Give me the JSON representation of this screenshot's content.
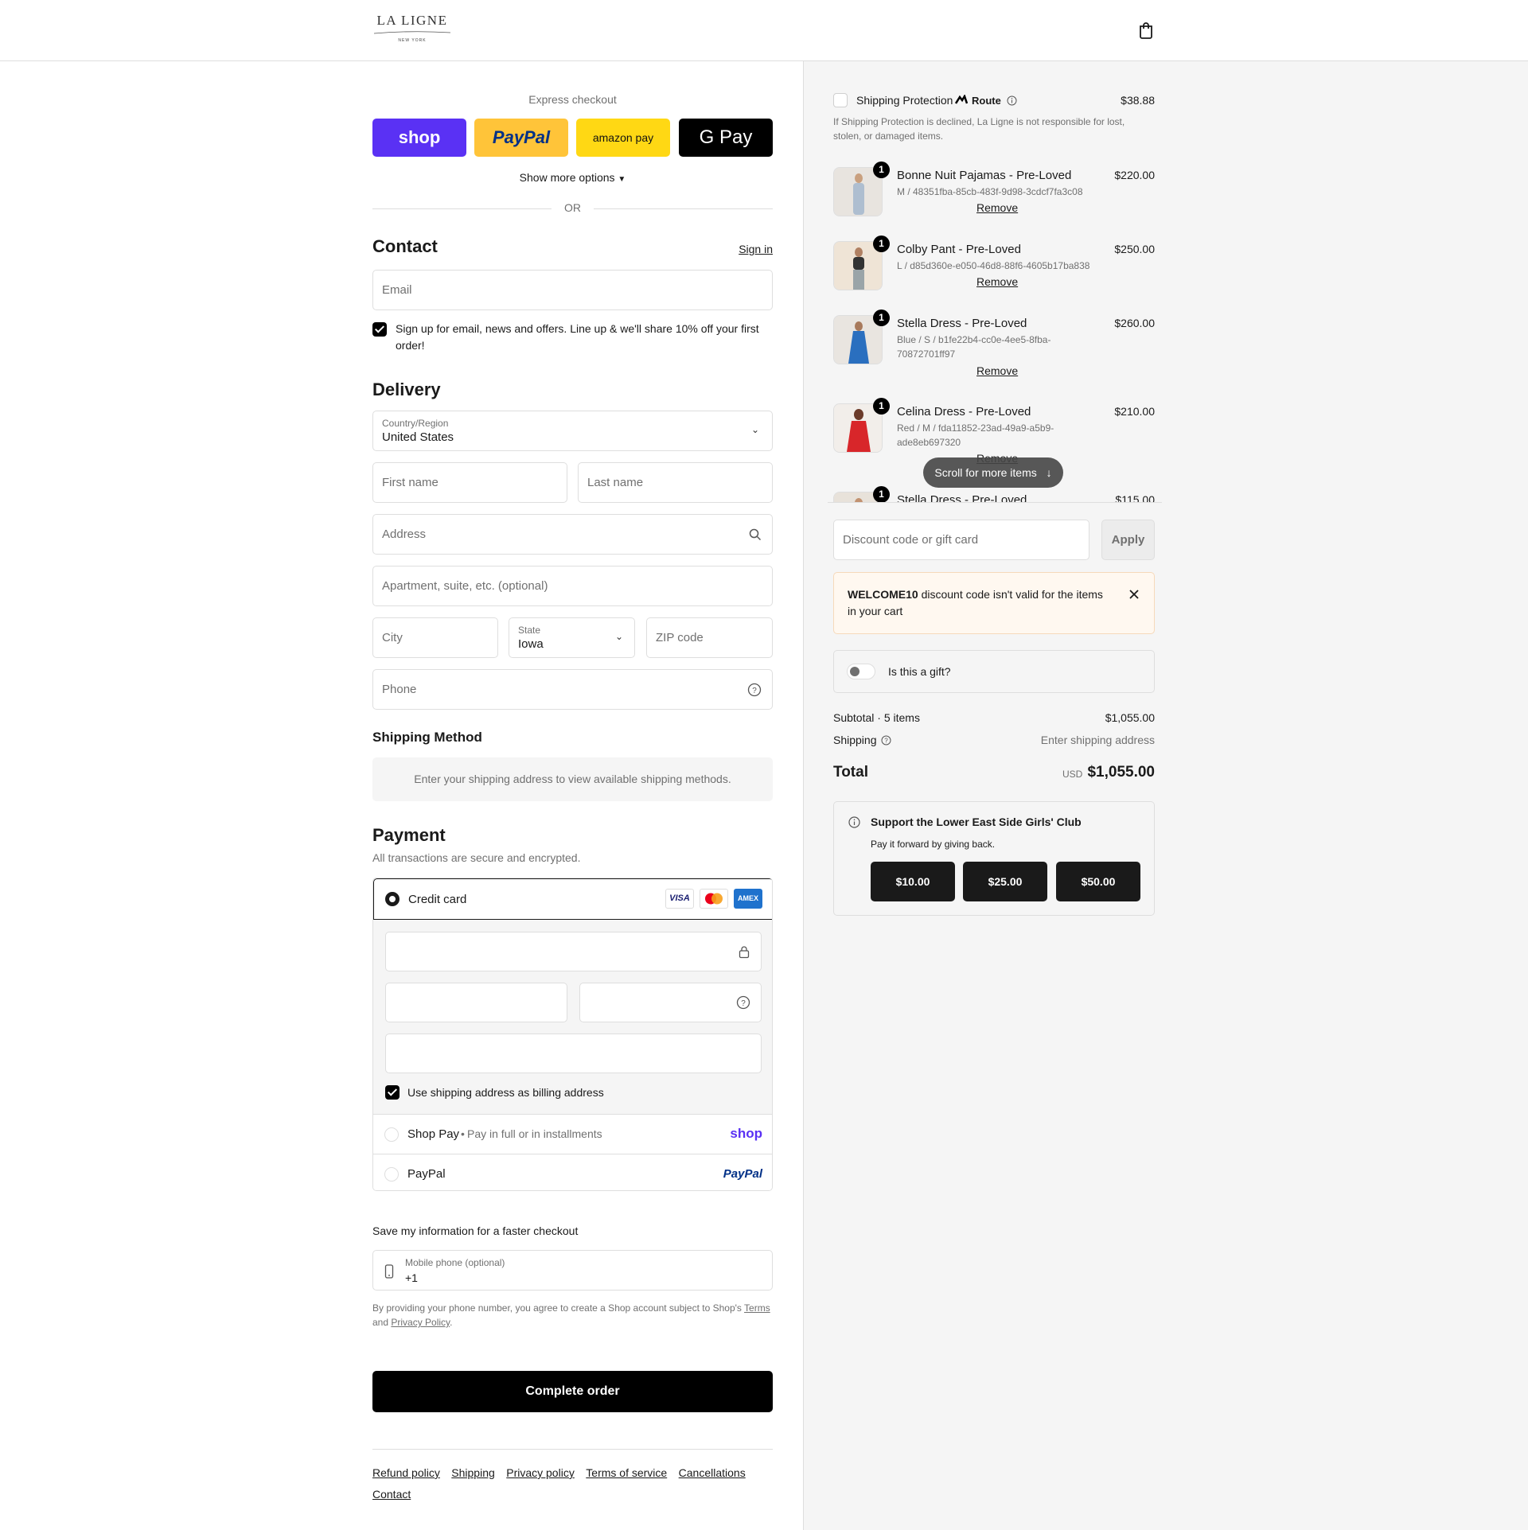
{
  "header": {
    "logo_text": "LA LIGNE",
    "logo_sub": "NEW YORK",
    "cart_icon": "bag-icon"
  },
  "express": {
    "title": "Express checkout",
    "buttons": [
      "shop",
      "PayPal",
      "amazon pay",
      "G Pay"
    ],
    "more": "Show more options",
    "or": "OR",
    "colors": {
      "shop": "#5a31f4",
      "paypal": "#ffc439",
      "amazon": "#ffd814",
      "gpay": "#000000"
    }
  },
  "contact": {
    "title": "Contact",
    "signin": "Sign in",
    "email_placeholder": "Email",
    "newsletter": "Sign up for email, news and offers. Line up & we'll share 10% off your first order!"
  },
  "delivery": {
    "title": "Delivery",
    "country_label": "Country/Region",
    "country": "United States",
    "first_name": "First name",
    "last_name": "Last name",
    "address": "Address",
    "apartment": "Apartment, suite, etc. (optional)",
    "city": "City",
    "state_label": "State",
    "state": "Iowa",
    "zip": "ZIP code",
    "phone": "Phone"
  },
  "shipping_method": {
    "title": "Shipping Method",
    "message": "Enter your shipping address to view available shipping methods."
  },
  "payment": {
    "title": "Payment",
    "subtitle": "All transactions are secure and encrypted.",
    "credit_card": "Credit card",
    "cards": [
      "VISA",
      "Mastercard",
      "AMEX"
    ],
    "billing": "Use shipping address as billing address",
    "shop_pay": "Shop Pay",
    "shop_pay_note": "Pay in full or in installments",
    "shop_logo": "shop",
    "paypal": "PayPal",
    "paypal_logo": "PayPal"
  },
  "save_info": {
    "title": "Save my information for a faster checkout",
    "mobile_label": "Mobile phone (optional)",
    "mobile_value": "+1",
    "legal_prefix": "By providing your phone number, you agree to create a Shop account subject to Shop's",
    "terms": "Terms",
    "and": "and",
    "privacy": "Privacy Policy",
    "period": "."
  },
  "complete_order": "Complete order",
  "footer_links": [
    "Refund policy",
    "Shipping",
    "Privacy policy",
    "Terms of service",
    "Cancellations",
    "Contact"
  ],
  "summary": {
    "protection": {
      "label": "Shipping Protection",
      "brand": "Route",
      "price": "$38.88",
      "note": "If Shipping Protection is declined, La Ligne is not responsible for lost, stolen, or damaged items."
    },
    "items": [
      {
        "qty": "1",
        "name": "Bonne Nuit Pajamas - Pre-Loved",
        "variant": "M / 48351fba-85cb-483f-9d98-3cdcf7fa3c08",
        "price": "$220.00",
        "remove": "Remove"
      },
      {
        "qty": "1",
        "name": "Colby Pant - Pre-Loved",
        "variant": "L / d85d360e-e050-46d8-88f6-4605b17ba838",
        "price": "$250.00",
        "remove": "Remove"
      },
      {
        "qty": "1",
        "name": "Stella Dress - Pre-Loved",
        "variant": "Blue / S / b1fe22b4-cc0e-4ee5-8fba-70872701ff97",
        "price": "$260.00",
        "remove": "Remove"
      },
      {
        "qty": "1",
        "name": "Celina Dress - Pre-Loved",
        "variant": "Red / M / fda11852-23ad-49a9-a5b9-ade8eb697320",
        "price": "$210.00",
        "remove": "Remove"
      },
      {
        "qty": "1",
        "name": "Stella Dress - Pre-Loved",
        "price": "$115.00"
      }
    ],
    "scroll_more": "Scroll for more items",
    "discount_placeholder": "Discount code or gift card",
    "apply": "Apply",
    "discount_error_code": "WELCOME10",
    "discount_error_msg": "discount code isn't valid for the items in your cart",
    "gift": "Is this a gift?",
    "subtotal_label": "Subtotal · 5 items",
    "subtotal": "$1,055.00",
    "shipping_label": "Shipping",
    "shipping_value": "Enter shipping address",
    "total_label": "Total",
    "currency": "USD",
    "total": "$1,055.00",
    "donation": {
      "title": "Support the Lower East Side Girls' Club",
      "subtitle": "Pay it forward by giving back.",
      "amounts": [
        "$10.00",
        "$25.00",
        "$50.00"
      ]
    }
  }
}
